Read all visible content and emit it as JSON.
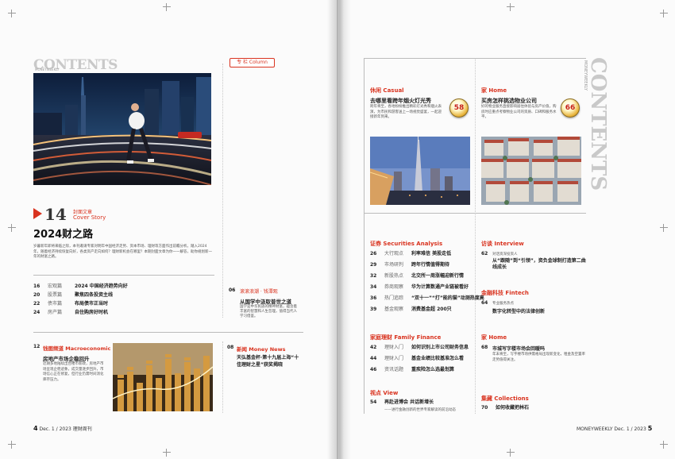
{
  "left": {
    "contents_word": "CONTENTS",
    "contents_sub": "MONEYWEEKLY",
    "column_badge": "专 栏 Column",
    "cover": {
      "number": "14",
      "label_cn": "封面文章",
      "label_en": "Cover Story",
      "title": "2024财之路",
      "blurb": "岁暮新年即将来临之际，本刊邀请专家对明年中国经济走势、资本市场、理财等方面作出前瞻分析。踏入2024年，随着经济持续恢复向好，各类资产走向如何？理财新机会在哪里？本期封面文章为你一一解答，助你规划新一年的财富之路。"
    },
    "cover_items": [
      {
        "num": "16",
        "cat": "宏观篇",
        "title": "2024 中国经济趋势向好"
      },
      {
        "num": "20",
        "cat": "股票篇",
        "title": "聚焦四条投资主线"
      },
      {
        "num": "22",
        "cat": "债市篇",
        "title": "布局债市正当时"
      },
      {
        "num": "24",
        "cat": "房产篇",
        "title": "自住购房好时机"
      }
    ],
    "column_item": {
      "num": "06",
      "cat": "滚滚浪潮 · 钱潭观",
      "title": "从国学中汲取普世之道",
      "blurb": "国学是中华民族的精神财富，蕴含着丰富的智慧和人生哲理，值得当代人学习借鉴。"
    },
    "macro": {
      "num": "12",
      "label": "钱图频道 Macroeconomic",
      "title": "房地产市场企稳回升",
      "blurb": "近期多地陆续出台楼市新政，房地产市场呈现企稳迹象，成交量逐步回升，市场信心正在修复，但行业仍需时间消化库存压力。"
    },
    "money_news": {
      "num": "08",
      "label": "新闻 Money News",
      "title": "天弘基金杯·第十九届上海“十佳理财之星”获奖揭晓"
    },
    "folio_num": "4",
    "folio_text": "Dec. 1 / 2023  理财周刊"
  },
  "right": {
    "contents_word": "CONTENTS",
    "contents_sub": "MONEYWEEKLY",
    "casual": {
      "label": "休闲 Casual",
      "title": "去哪里看跨年烟火灯光秀",
      "blurb": "跨年将至，各地纷纷推出精彩灯光秀和烟火表演，为市民和游客送上一场视觉盛宴，一起迎接新年到来。",
      "badge": "58"
    },
    "home": {
      "label": "家 Home",
      "title": "买房怎样挑选物业公司",
      "blurb": "好的物业服务直接影响居住体验与房产价值，购房时应重点考察物业公司的资质、口碑和服务水平。",
      "badge": "66"
    },
    "securities": {
      "label": "证券 Securities Analysis",
      "items": [
        {
          "num": "26",
          "cat": "大行观点",
          "title": "利率难信 美股走低"
        },
        {
          "num": "29",
          "cat": "市场研判",
          "title": "跨年行情值得期待"
        },
        {
          "num": "32",
          "cat": "新股热点",
          "title": "北交所一周涨幅迎新行情"
        },
        {
          "num": "34",
          "cat": "券商观察",
          "title": "华为计算数通产业链被看好"
        },
        {
          "num": "36",
          "cat": "热门追踪",
          "title": "“双十一”“打”能的猫”动测热度高"
        },
        {
          "num": "39",
          "cat": "基金观察",
          "title": "消费基金超 200只"
        }
      ]
    },
    "family": {
      "label": "家庭理财 Family Finance",
      "items": [
        {
          "num": "42",
          "cat": "理财入门",
          "title": "如何识别上市公司财务信息"
        },
        {
          "num": "44",
          "cat": "理财入门",
          "title": "基金业绩比较基准怎么看"
        },
        {
          "num": "46",
          "cat": "资讯话题",
          "title": "重疾险怎么选最划算"
        }
      ]
    },
    "view": {
      "label": "视点 View",
      "num": "54",
      "title": "再赴进博会 共话新增长",
      "sub": "——进行金融创新的世界专家解读的前沿动态"
    },
    "interview": {
      "label": "访谈 Interview",
      "num": "62",
      "cat": "对话资深投资人",
      "title": "从“跟随”到“引领”，资负金球制打造第二曲线成长"
    },
    "fintech": {
      "label": "金融科技 Fintech",
      "num": "64",
      "cat": "专业服务热点",
      "title": "数字化转型中的法律创新"
    },
    "home2": {
      "label": "家 Home",
      "num": "68",
      "title": "市城写字楼市场会回暖吗",
      "blurb": "年末将至，写字楼市场供需格局出现新变化，租金及空置率走势值得关注。"
    },
    "collections": {
      "label": "集藏 Collections",
      "num": "70",
      "title": "如何收藏把林石"
    },
    "folio_num": "5",
    "folio_text": "MONEYWEEKLY  Dec. 1 / 2023"
  }
}
